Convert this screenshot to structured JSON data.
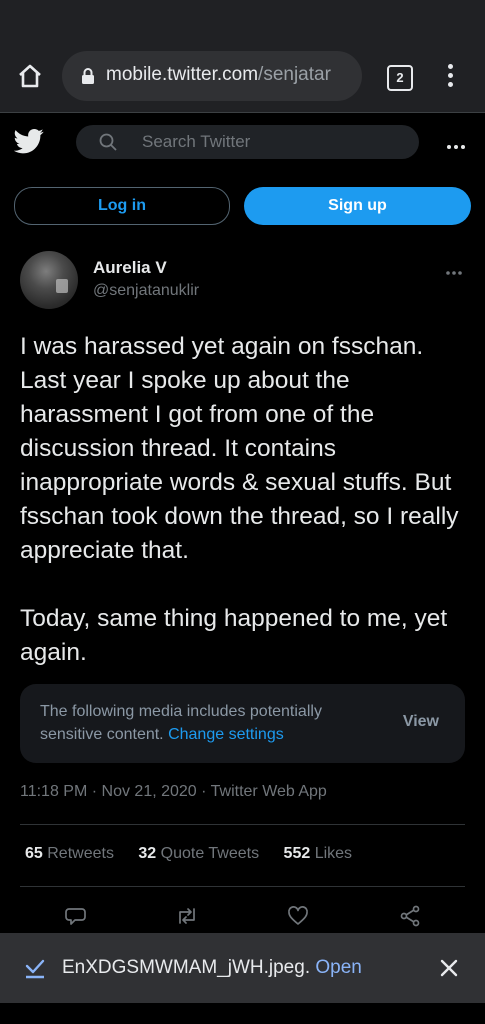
{
  "browser": {
    "url_domain": "mobile.twitter.com",
    "url_path": "/senjatar",
    "tab_count": "2",
    "icons": [
      "home-icon",
      "lock-icon",
      "tabs-icon",
      "menu-icon"
    ]
  },
  "header": {
    "search_placeholder": "Search Twitter",
    "icons": [
      "twitter-logo-icon",
      "search-icon",
      "more-icon"
    ]
  },
  "auth": {
    "login_label": "Log in",
    "signup_label": "Sign up"
  },
  "tweet": {
    "author_name": "Aurelia V",
    "handle": "@senjatanuklir",
    "text": "I was harassed yet again on fsschan. Last year I spoke up about the harassment I got from one of the discussion thread. It contains inappropriate words & sexual stuffs. But fsschan took down the thread, so I really appreciate that.\n\nToday, same thing happened to me, yet again.",
    "sensitive_notice": "The following media includes potentially sensitive content.",
    "sensitive_link": "Change settings",
    "view_label": "View",
    "timestamp": "11:18 PM · Nov 21, 2020 · Twitter Web App",
    "retweets_count": "65",
    "retweets_label": "Retweets",
    "quotes_count": "32",
    "quotes_label": "Quote Tweets",
    "likes_count": "552",
    "likes_label": "Likes",
    "action_icons": [
      "reply-icon",
      "retweet-icon",
      "like-icon",
      "share-icon"
    ]
  },
  "download": {
    "filename": "EnXDGSMWMAM_jWH.jpeg.",
    "open_label": "Open"
  },
  "colors": {
    "accent": "#1d9bf0",
    "background": "#000000",
    "chrome": "#202124",
    "download_link": "#8ab4f8"
  }
}
